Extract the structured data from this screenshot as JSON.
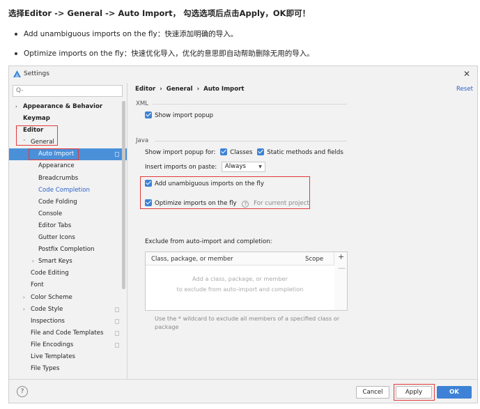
{
  "intro": {
    "title": "选择Editor -> General -> Auto Import， 勾选选项后点击Apply，OK即可！",
    "bullets": [
      "Add unambiguous imports on the fly：快速添加明确的导入。",
      "Optimize imports on the fly：快速优化导入，优化的意思即自动帮助删除无用的导入。"
    ]
  },
  "window": {
    "title": "Settings",
    "close_glyph": "✕"
  },
  "sidebar": {
    "search_placeholder": "Q-",
    "items": [
      {
        "label": "Appearance & Behavior",
        "arrow": "›"
      },
      {
        "label": "Keymap"
      },
      {
        "label": "Editor",
        "arrow": "˅"
      },
      {
        "label": "General",
        "arrow": "˅"
      },
      {
        "label": "Auto Import"
      },
      {
        "label": "Appearance"
      },
      {
        "label": "Breadcrumbs"
      },
      {
        "label": "Code Completion"
      },
      {
        "label": "Code Folding"
      },
      {
        "label": "Console"
      },
      {
        "label": "Editor Tabs"
      },
      {
        "label": "Gutter Icons"
      },
      {
        "label": "Postfix Completion"
      },
      {
        "label": "Smart Keys",
        "arrow": "›"
      },
      {
        "label": "Code Editing"
      },
      {
        "label": "Font"
      },
      {
        "label": "Color Scheme",
        "arrow": "›"
      },
      {
        "label": "Code Style",
        "arrow": "›"
      },
      {
        "label": "Inspections"
      },
      {
        "label": "File and Code Templates"
      },
      {
        "label": "File Encodings"
      },
      {
        "label": "Live Templates"
      },
      {
        "label": "File Types"
      }
    ]
  },
  "panel": {
    "breadcrumb": [
      "Editor",
      "General",
      "Auto Import"
    ],
    "breadcrumb_sep": "›",
    "reset_label": "Reset",
    "xml_section": "XML",
    "show_import_popup": "Show import popup",
    "java_section": "Java",
    "show_popup_for": "Show import popup for:",
    "classes_label": "Classes",
    "static_label": "Static methods and fields",
    "insert_label": "Insert imports on paste:",
    "insert_value": "Always",
    "add_unambiguous": "Add unambiguous imports on the fly",
    "optimize": "Optimize imports on the fly",
    "for_current_project": "For current project",
    "exclude_label": "Exclude from auto-import and completion:",
    "table": {
      "col_name": "Class, package, or member",
      "col_scope": "Scope",
      "empty_line1": "Add a class, package, or member",
      "empty_line2": "to exclude from auto-import and completion"
    },
    "wildcard_note": "Use the * wildcard to exclude all members of a specified class or package"
  },
  "footer": {
    "help_glyph": "?",
    "cancel": "Cancel",
    "apply": "Apply",
    "ok": "OK"
  },
  "colors": {
    "accent": "#3d82d6",
    "selection": "#4a90d9",
    "highlight_box": "#e23a3a",
    "link": "#2c62c5"
  }
}
